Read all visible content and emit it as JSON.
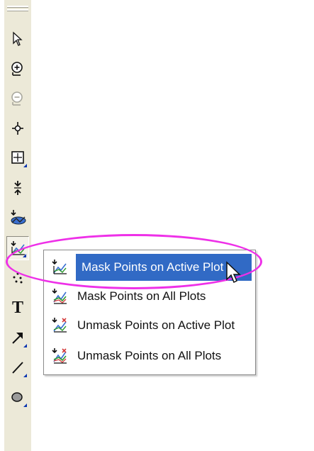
{
  "toolbar": {
    "tools": [
      {
        "name": "pointer-icon"
      },
      {
        "name": "zoom-in-icon"
      },
      {
        "name": "zoom-out-icon"
      },
      {
        "name": "data-reader-icon"
      },
      {
        "name": "screen-reader-icon"
      },
      {
        "name": "data-selector-icon"
      },
      {
        "name": "draw-data-icon"
      },
      {
        "name": "mask-points-icon",
        "pressed": true
      },
      {
        "name": "scatter-icon"
      },
      {
        "name": "text-tool-icon",
        "label": "T"
      },
      {
        "name": "arrow-tool-icon"
      },
      {
        "name": "line-tool-icon"
      },
      {
        "name": "ellipse-tool-icon"
      }
    ]
  },
  "menu": {
    "items": [
      {
        "label": "Mask Points on Active Plot",
        "selected": true
      },
      {
        "label": "Mask Points on All Plots",
        "selected": false
      },
      {
        "label": "Unmask Points on Active Plot",
        "selected": false
      },
      {
        "label": "Unmask Points on All Plots",
        "selected": false
      }
    ]
  },
  "colors": {
    "selection": "#316ac5",
    "annotation": "#ee30e8",
    "toolbar_bg": "#ece9d8"
  }
}
